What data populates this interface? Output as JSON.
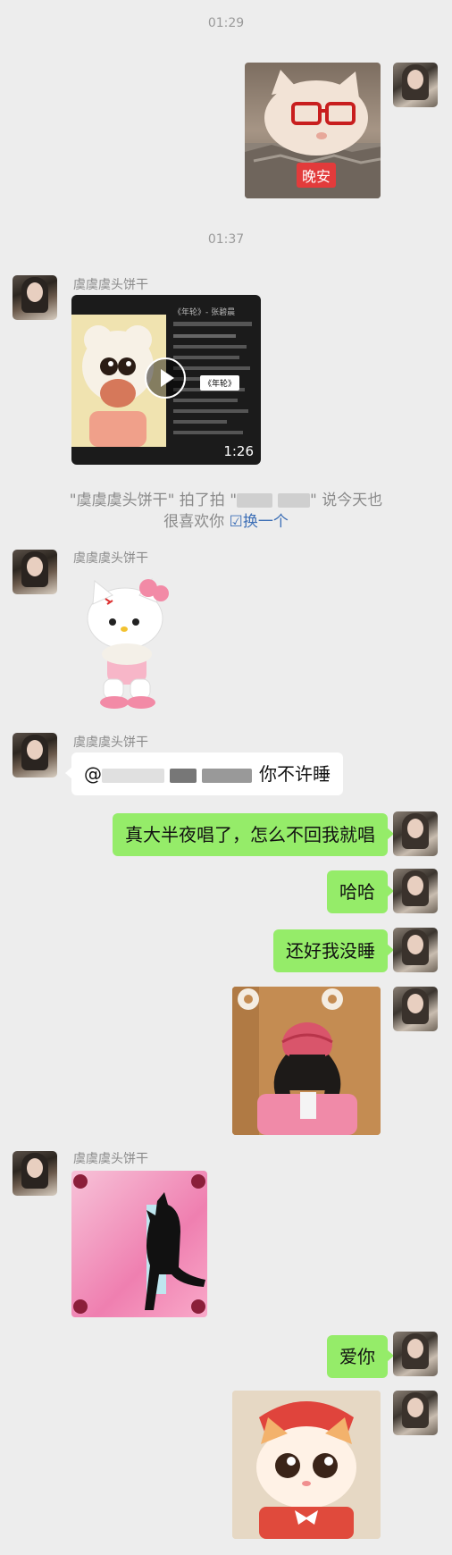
{
  "times": [
    "01:29",
    "01:37"
  ],
  "contact_name": "虞虞虞头饼干",
  "stickers": {
    "goodnight_caption": "晚安"
  },
  "video": {
    "duration": "1:26",
    "inner_title": "《年轮》",
    "inner_app_label": "《年轮》- 张碧晨"
  },
  "pat": {
    "line1_prefix": "\"虞虞虞头饼干\" 拍了拍 \"",
    "line1_suffix": "\" 说今天也",
    "line2_text": "很喜欢你",
    "line2_link": "换一个"
  },
  "messages": {
    "mention_prefix": "@",
    "mention_text": "你不许睡",
    "m1": "真大半夜唱了，怎么不回我就唱",
    "m2": "哈哈",
    "m3": "还好我没睡",
    "m4": "爱你"
  },
  "colors": {
    "background": "#ededed",
    "my_bubble": "#95ec69",
    "their_bubble": "#ffffff",
    "link": "#3d6fb6"
  }
}
